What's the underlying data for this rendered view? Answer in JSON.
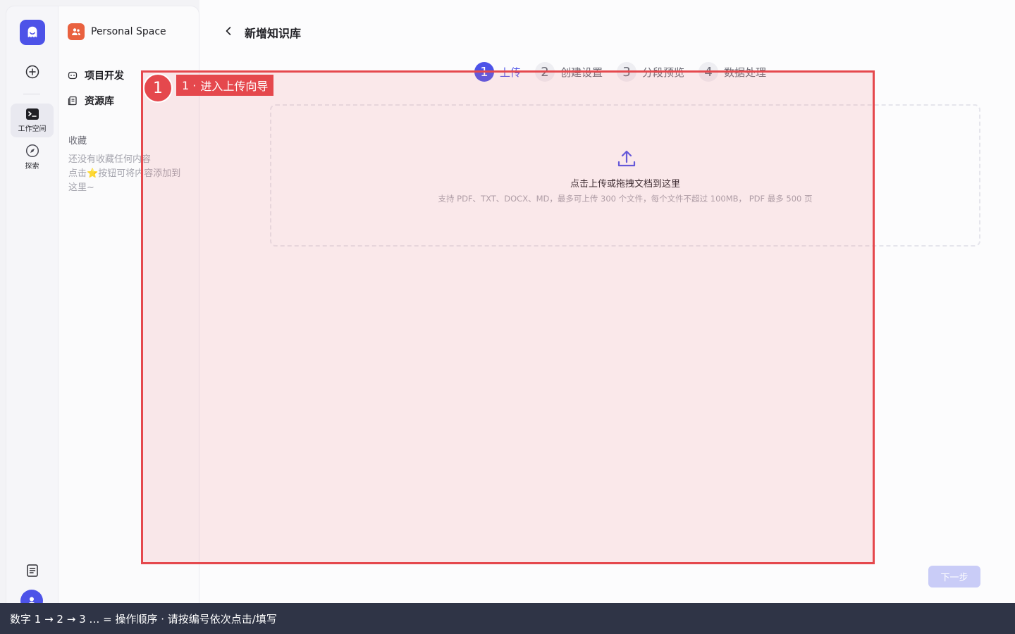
{
  "sidebar_rail": {
    "items": [
      {
        "label": "工作空间",
        "icon": "workspace-icon",
        "active": true
      },
      {
        "label": "探索",
        "icon": "compass-icon",
        "active": false
      }
    ]
  },
  "side_panel": {
    "space_name": "Personal Space",
    "nav": [
      {
        "label": "项目开发",
        "icon": "bot-icon"
      },
      {
        "label": "资源库",
        "icon": "library-icon"
      }
    ],
    "favorites_title": "收藏",
    "favorites_empty_1": "还没有收藏任何内容",
    "favorites_empty_2_a": "点击",
    "favorites_empty_2_star": "⭐",
    "favorites_empty_2_b": "按钮可将内容添加到",
    "favorites_empty_3": "这里~"
  },
  "main": {
    "title": "新增知识库",
    "steps": [
      {
        "num": "1",
        "label": "上传",
        "active": true
      },
      {
        "num": "2",
        "label": "创建设置",
        "active": false
      },
      {
        "num": "3",
        "label": "分段预览",
        "active": false
      },
      {
        "num": "4",
        "label": "数据处理",
        "active": false
      }
    ],
    "upload_title": "点击上传或拖拽文档到这里",
    "upload_hint": "支持 PDF、TXT、DOCX、MD，最多可上传 300 个文件，每个文件不超过 100MB， PDF 最多 500 页",
    "next_label": "下一步"
  },
  "annotation": {
    "number": "1",
    "label_prefix": "1 ·",
    "label_text": "进入上传向导"
  },
  "hint_bar": {
    "text": "数字 1 → 2 → 3 … = 操作顺序 ·   请按编号依次点击/填写"
  },
  "colors": {
    "accent": "#4d53e8",
    "annotation": "#e5484d",
    "space_badge": "#e9613f"
  }
}
